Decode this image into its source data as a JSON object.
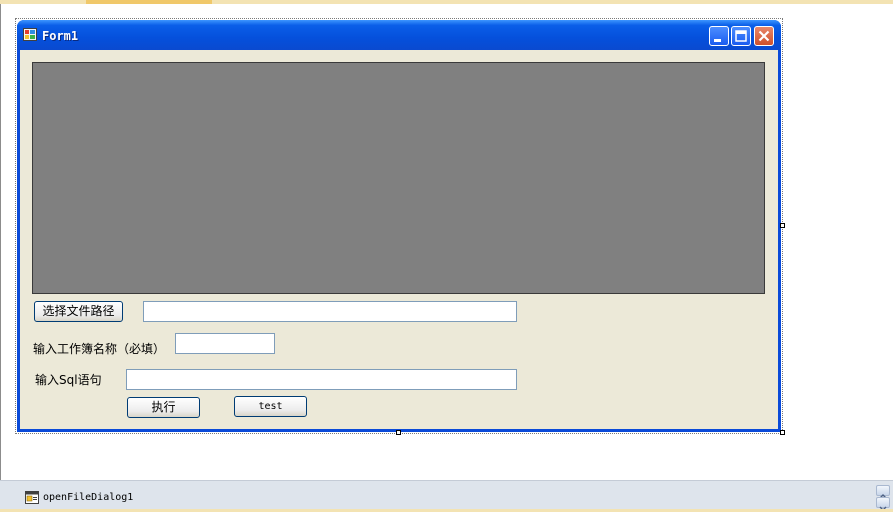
{
  "window": {
    "title": "Form1",
    "buttons": {
      "minimize_icon": "minimize-icon",
      "maximize_icon": "maximize-icon",
      "close_icon": "close-icon"
    }
  },
  "form": {
    "select_path_button": "选择文件路径",
    "file_path_value": "",
    "workbook_label": "输入工作簿名称（必填）",
    "workbook_value": "",
    "sql_label": "输入Sql语句",
    "sql_value": "",
    "execute_button": "执行",
    "test_button": "test"
  },
  "tray": {
    "component_label": "openFileDialog1"
  },
  "colors": {
    "titlebar": "#0550dc",
    "client": "#ece9d8",
    "panel": "#808080",
    "tray": "#dee4ec"
  }
}
